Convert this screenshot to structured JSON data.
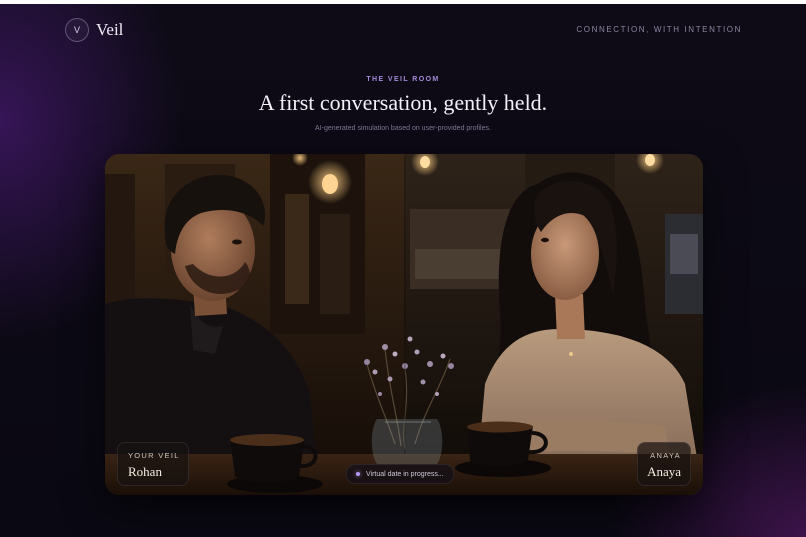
{
  "brand": {
    "mark": "V",
    "name": "Veil",
    "tagline": "CONNECTION, WITH INTENTION"
  },
  "hero": {
    "eyebrow": "THE VEIL ROOM",
    "headline": "A first conversation, gently held.",
    "subtitle": "AI-generated simulation based on user-provided profiles."
  },
  "scene": {
    "left_badge": {
      "kicker": "YOUR VEIL",
      "name": "Rohan"
    },
    "right_badge": {
      "kicker": "ANAYA",
      "name": "Anaya"
    },
    "status": "Virtual date in progress..."
  },
  "colors": {
    "background": "#0b0912",
    "accent": "#a58bdc",
    "status_dot": "#b49af0"
  }
}
